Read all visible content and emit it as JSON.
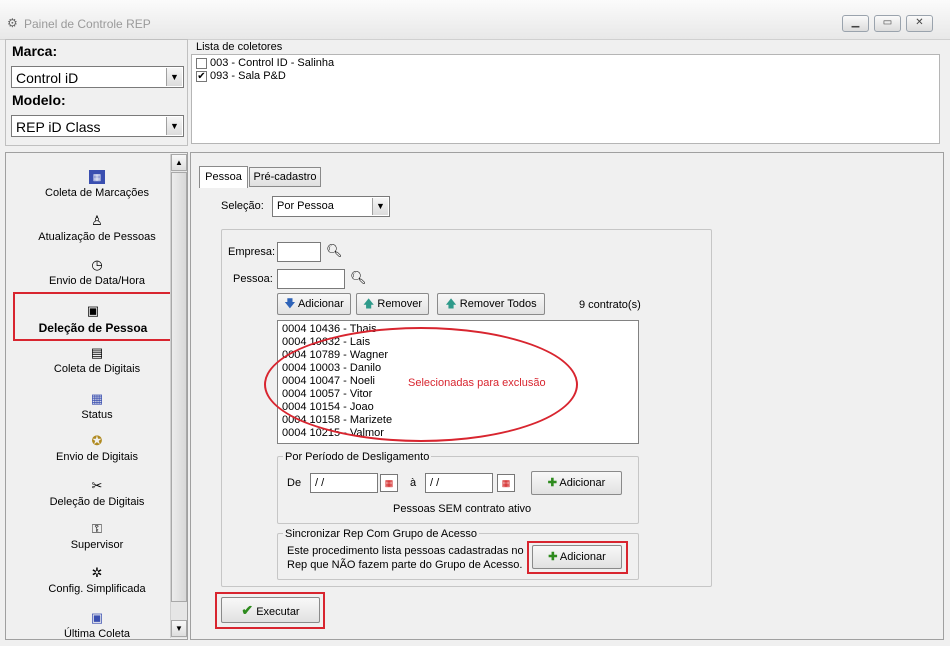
{
  "window": {
    "title": "Painel de Controle REP"
  },
  "brand": {
    "marca_label": "Marca:",
    "marca_value": "Control iD",
    "modelo_label": "Modelo:",
    "modelo_value": "REP iD Class"
  },
  "coletores": {
    "title": "Lista de coletores",
    "items": [
      {
        "label": "003 - Control ID - Salinha",
        "checked": false
      },
      {
        "label": "093 - Sala P&D",
        "checked": true
      }
    ]
  },
  "sidebar": {
    "items": [
      {
        "label": "Coleta de Marcações",
        "icon": "keyboard-icon"
      },
      {
        "label": "Atualização de Pessoas",
        "icon": "person-update-icon"
      },
      {
        "label": "Envio de Data/Hora",
        "icon": "clock-icon"
      },
      {
        "label": "Deleção de Pessoa",
        "icon": "person-delete-icon"
      },
      {
        "label": "Coleta de Digitais",
        "icon": "fingerprint-collect-icon"
      },
      {
        "label": "Status",
        "icon": "status-icon"
      },
      {
        "label": "Envio de Digitais",
        "icon": "fingerprint-send-icon"
      },
      {
        "label": "Deleção de Digitais",
        "icon": "scissors-icon"
      },
      {
        "label": "Supervisor",
        "icon": "supervisor-icon"
      },
      {
        "label": "Config. Simplificada",
        "icon": "config-icon"
      },
      {
        "label": "Última Coleta",
        "icon": "last-collect-icon"
      }
    ]
  },
  "tabs": [
    {
      "label": "Pessoa"
    },
    {
      "label": "Pré-cadastro"
    }
  ],
  "selecao": {
    "label": "Seleção:",
    "value": "Por Pessoa"
  },
  "form": {
    "empresa_label": "Empresa:",
    "pessoa_label": "Pessoa:",
    "adicionar": "Adicionar",
    "remover": "Remover",
    "remover_todos": "Remover Todos",
    "count": "9 contrato(s)",
    "annotation": "Selecionadas para exclusão",
    "people": [
      "0004 10436 - Thais",
      "0004 10632 - Lais",
      "0004 10789 - Wagner",
      "0004 10003 - Danilo",
      "0004 10047 - Noeli",
      "0004 10057 - Vitor",
      "0004 10154 - Joao",
      "0004 10158 - Marizete",
      "0004 10215 - Valmor"
    ]
  },
  "periodo": {
    "title": "Por Período de Desligamento",
    "de": "De",
    "a": "à",
    "from": " / /",
    "to": " / /",
    "adicionar": "Adicionar",
    "note": "Pessoas SEM contrato ativo"
  },
  "sync": {
    "title": "Sincronizar Rep Com Grupo de Acesso",
    "text1": "Este procedimento lista pessoas cadastradas no",
    "text2": "Rep que NÃO fazem parte do Grupo de Acesso.",
    "adicionar": "Adicionar"
  },
  "executar": {
    "label": "Executar"
  },
  "colors": {
    "highlight": "#d8252f",
    "green": "#2e8b1e"
  }
}
